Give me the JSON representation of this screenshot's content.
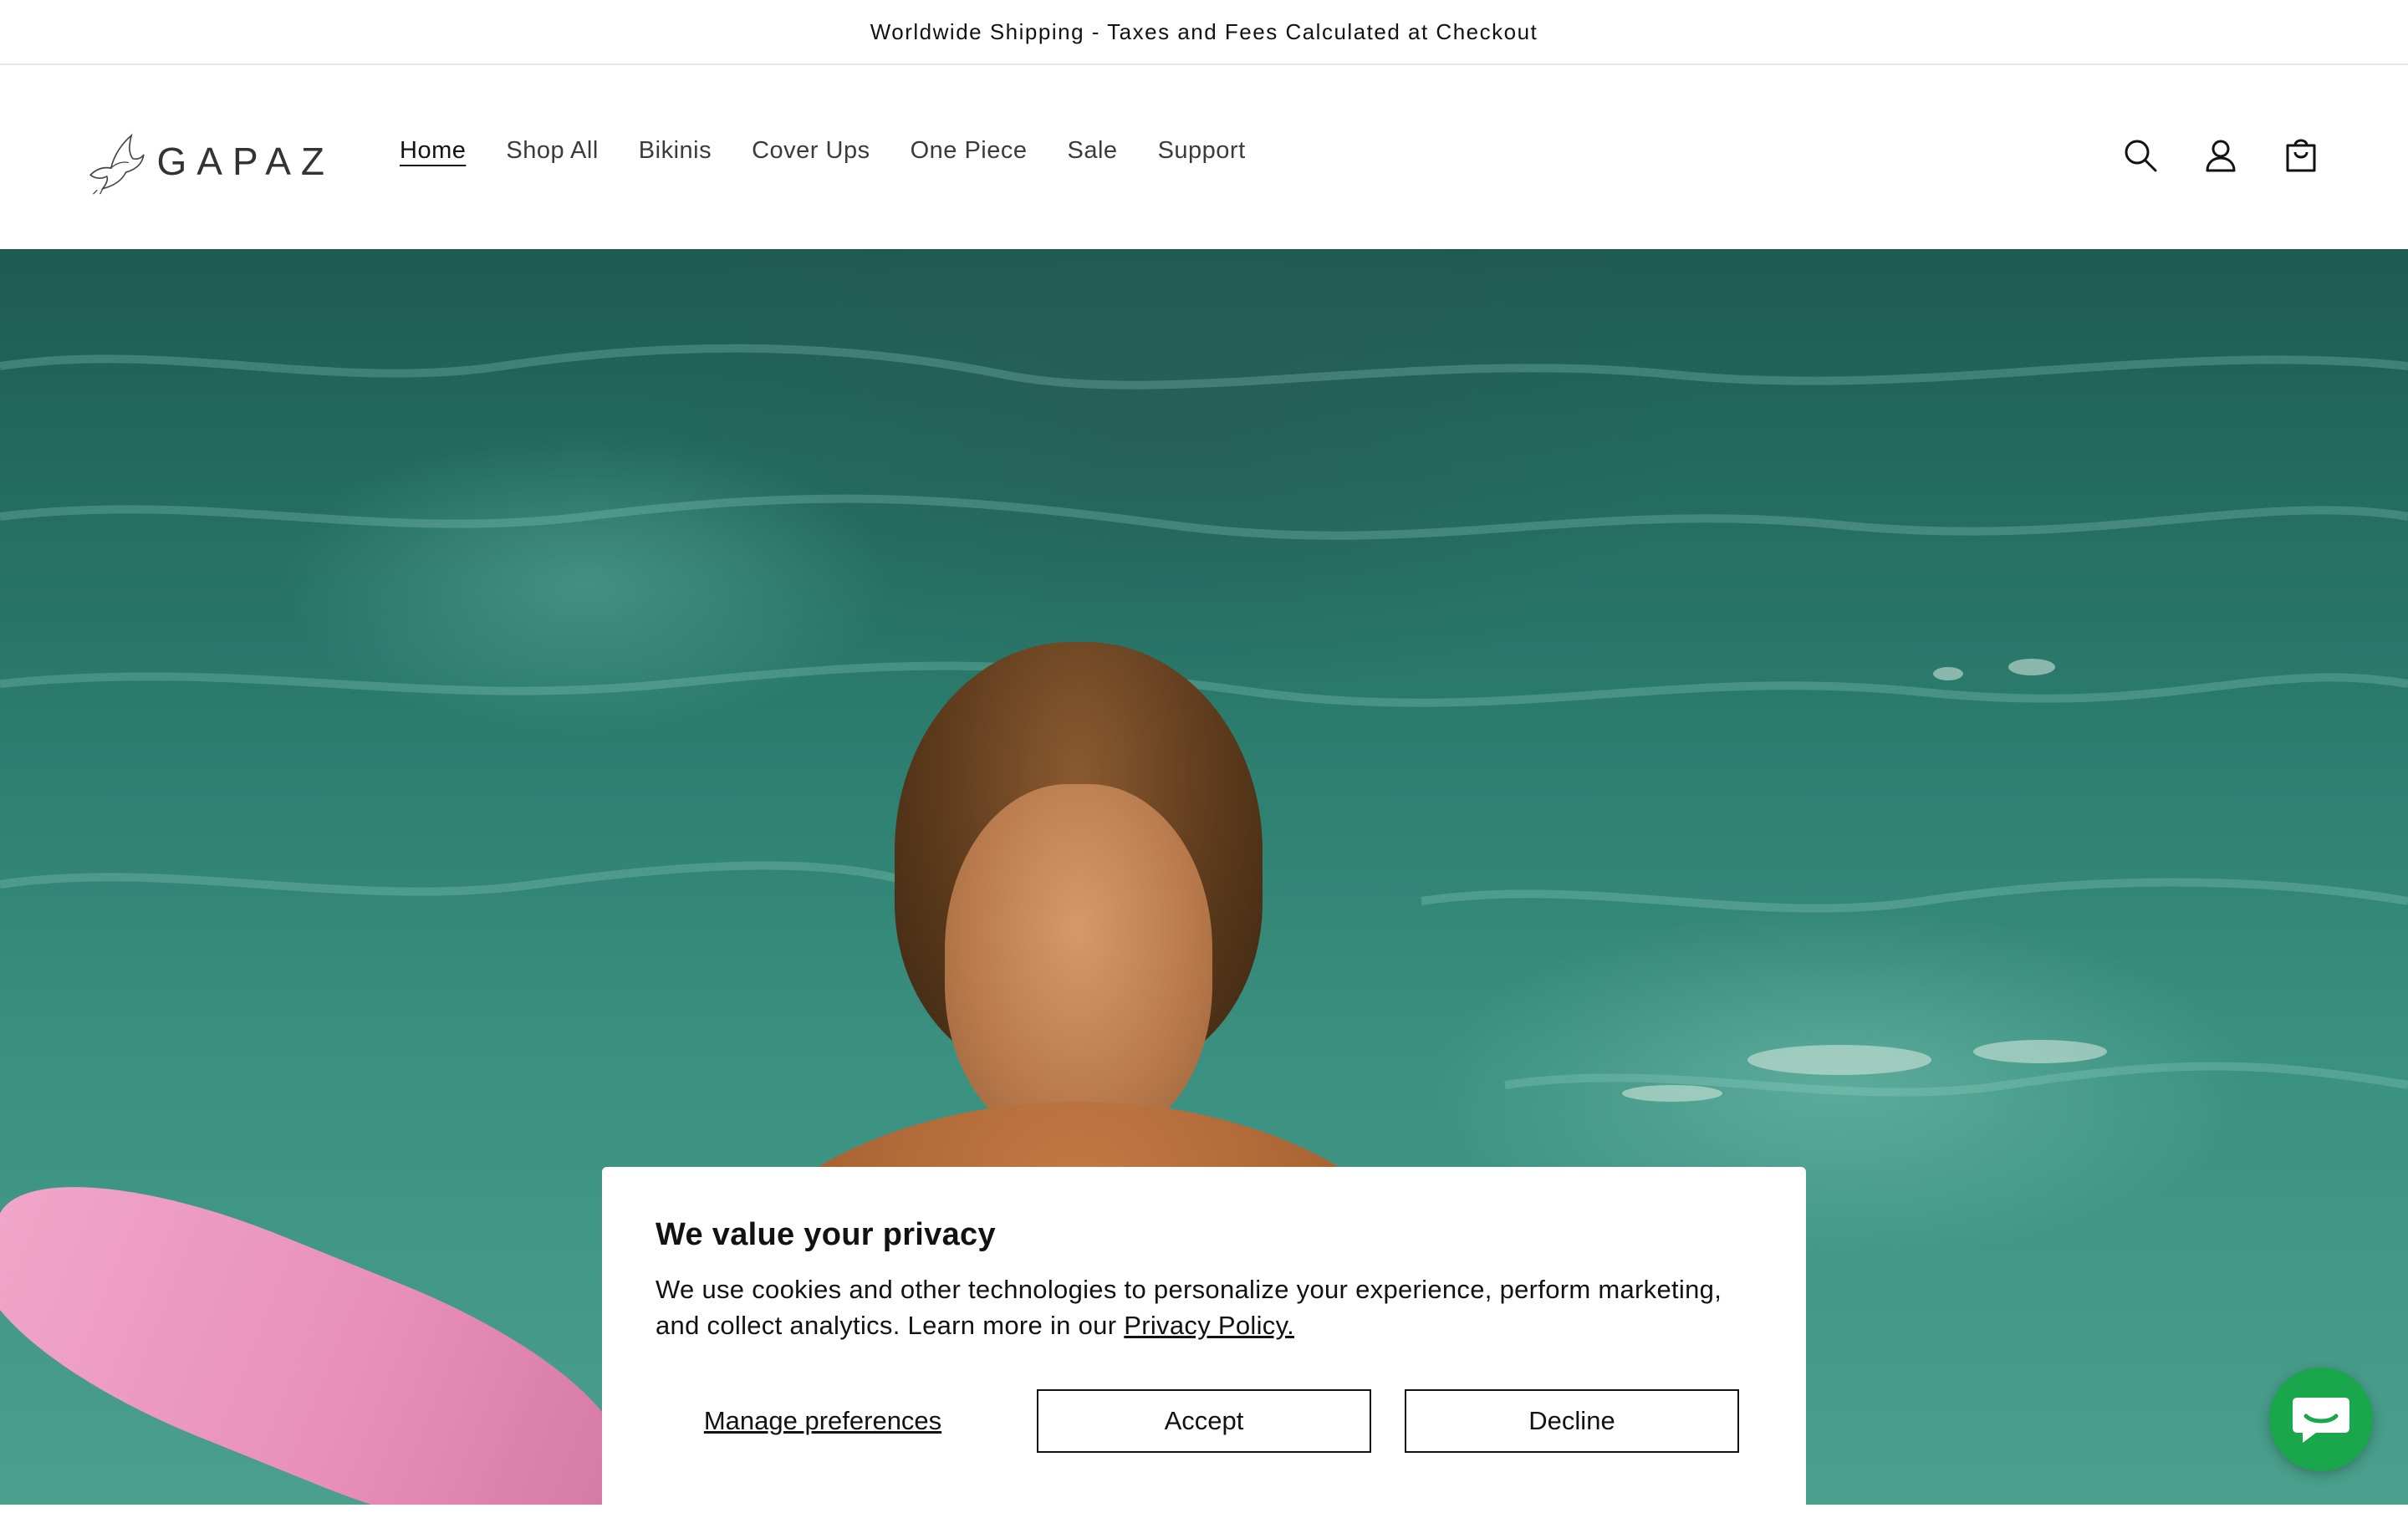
{
  "announcement": {
    "text": "Worldwide Shipping - Taxes and Fees Calculated at Checkout"
  },
  "header": {
    "logo_text": "GAPAZ",
    "nav": [
      {
        "label": "Home",
        "active": true
      },
      {
        "label": "Shop All"
      },
      {
        "label": "Bikinis"
      },
      {
        "label": "Cover Ups"
      },
      {
        "label": "One Piece"
      },
      {
        "label": "Sale"
      },
      {
        "label": "Support"
      }
    ],
    "icons": [
      "search-icon",
      "account-icon",
      "cart-icon"
    ]
  },
  "hero": {
    "image": "woman-in-pink-swimsuit-in-pool"
  },
  "cookie_banner": {
    "title": "We value your privacy",
    "text": "We use cookies and other technologies to personalize your experience, perform marketing, and collect analytics. Learn more in our",
    "link_text": "Privacy Policy.",
    "manage_label": "Manage preferences",
    "accept_label": "Accept",
    "decline_label": "Decline"
  },
  "chat": {
    "icon": "chat-bubble-icon",
    "color": "#1aa64a"
  }
}
